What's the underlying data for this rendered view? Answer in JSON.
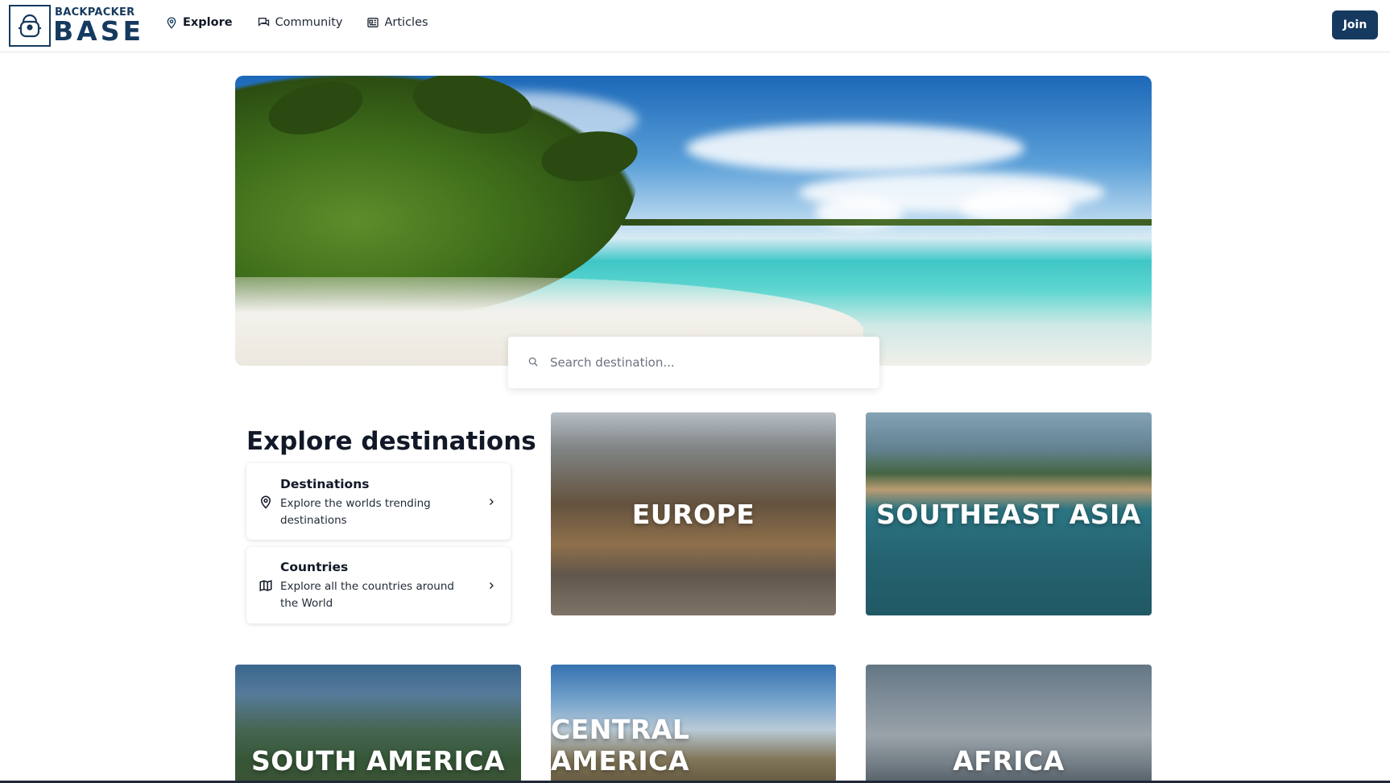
{
  "brand": {
    "small": "BACKPACKER",
    "big": "BASE"
  },
  "nav": [
    {
      "label": "Explore",
      "icon": "map-pin-icon",
      "active": true
    },
    {
      "label": "Community",
      "icon": "chat-icon",
      "active": false
    },
    {
      "label": "Articles",
      "icon": "newspaper-icon",
      "active": false
    }
  ],
  "join_label": "Join",
  "search": {
    "placeholder": "Search destination..."
  },
  "explore": {
    "title": "Explore destinations",
    "cards": [
      {
        "title": "Destinations",
        "desc": "Explore the worlds trending destinations",
        "icon": "map-pin-icon"
      },
      {
        "title": "Countries",
        "desc": "Explore all the countries around the World",
        "icon": "map-icon"
      }
    ]
  },
  "regions": [
    {
      "label": "EUROPE"
    },
    {
      "label": "SOUTHEAST ASIA"
    },
    {
      "label": "SOUTH AMERICA"
    },
    {
      "label": "CENTRAL AMERICA"
    },
    {
      "label": "AFRICA"
    }
  ],
  "colors": {
    "brand": "#163a5f",
    "text": "#111827"
  }
}
